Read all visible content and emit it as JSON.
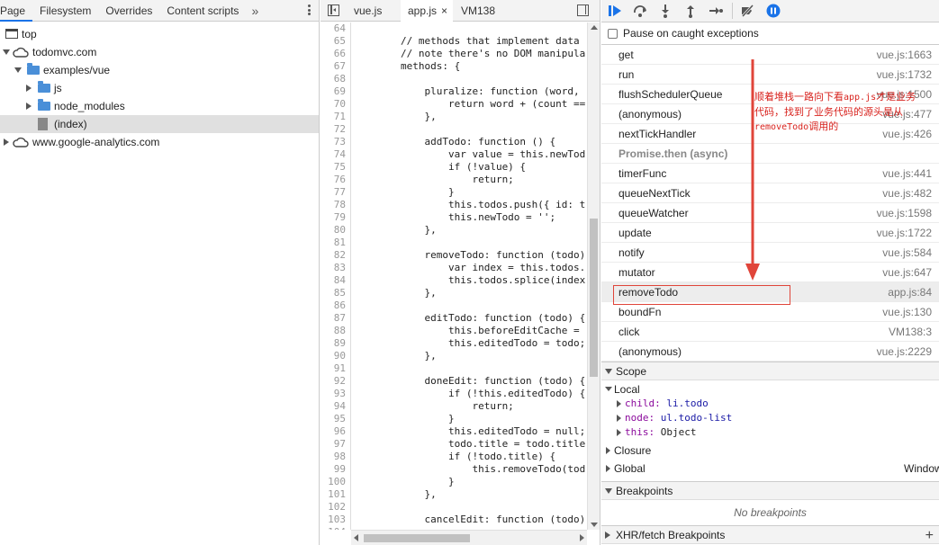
{
  "navigator": {
    "tabs": [
      "Page",
      "Filesystem",
      "Overrides",
      "Content scripts"
    ],
    "more": "»",
    "tree": [
      {
        "label": "top",
        "level": 0,
        "icon": "frame-icon",
        "arrow": "none"
      },
      {
        "label": "todomvc.com",
        "level": 0,
        "icon": "cloud-icon",
        "arrow": "down"
      },
      {
        "label": "examples/vue",
        "level": 1,
        "icon": "folder-icon",
        "arrow": "down"
      },
      {
        "label": "js",
        "level": 2,
        "icon": "folder-icon",
        "arrow": "right"
      },
      {
        "label": "node_modules",
        "level": 2,
        "icon": "folder-icon",
        "arrow": "right"
      },
      {
        "label": "(index)",
        "level": 2,
        "icon": "file-icon",
        "arrow": "none",
        "selected": true
      },
      {
        "label": "www.google-analytics.com",
        "level": 0,
        "icon": "cloud-icon",
        "arrow": "right"
      }
    ]
  },
  "editor": {
    "tabs": [
      {
        "label": "vue.js",
        "active": false
      },
      {
        "label": "app.js",
        "active": true,
        "close": "×"
      },
      {
        "label": "VM138",
        "active": false
      }
    ],
    "lines": [
      {
        "n": "64",
        "t": ""
      },
      {
        "n": "65",
        "t": "        // methods that implement data",
        "c": "cm"
      },
      {
        "n": "66",
        "t": "        // note there's no DOM manipula",
        "c": "cm"
      },
      {
        "n": "67",
        "t": "        methods: {"
      },
      {
        "n": "68",
        "t": ""
      },
      {
        "n": "69",
        "t": "            pluralize: function (word,"
      },
      {
        "n": "70",
        "t": "                return word + (count =="
      },
      {
        "n": "71",
        "t": "            },"
      },
      {
        "n": "72",
        "t": ""
      },
      {
        "n": "73",
        "t": "            addTodo: function () {"
      },
      {
        "n": "74",
        "t": "                var value = this.newTod"
      },
      {
        "n": "75",
        "t": "                if (!value) {"
      },
      {
        "n": "76",
        "t": "                    return;"
      },
      {
        "n": "77",
        "t": "                }"
      },
      {
        "n": "78",
        "t": "                this.todos.push({ id: t"
      },
      {
        "n": "79",
        "t": "                this.newTodo = '';"
      },
      {
        "n": "80",
        "t": "            },"
      },
      {
        "n": "81",
        "t": ""
      },
      {
        "n": "82",
        "t": "            removeTodo: function (todo)"
      },
      {
        "n": "83",
        "t": "                var index = this.todos."
      },
      {
        "n": "84",
        "t": "                this.todos.splice(index"
      },
      {
        "n": "85",
        "t": "            },"
      },
      {
        "n": "86",
        "t": ""
      },
      {
        "n": "87",
        "t": "            editTodo: function (todo) {"
      },
      {
        "n": "88",
        "t": "                this.beforeEditCache ="
      },
      {
        "n": "89",
        "t": "                this.editedTodo = todo;"
      },
      {
        "n": "90",
        "t": "            },"
      },
      {
        "n": "91",
        "t": ""
      },
      {
        "n": "92",
        "t": "            doneEdit: function (todo) {"
      },
      {
        "n": "93",
        "t": "                if (!this.editedTodo) {"
      },
      {
        "n": "94",
        "t": "                    return;"
      },
      {
        "n": "95",
        "t": "                }"
      },
      {
        "n": "96",
        "t": "                this.editedTodo = null;"
      },
      {
        "n": "97",
        "t": "                todo.title = todo.title"
      },
      {
        "n": "98",
        "t": "                if (!todo.title) {"
      },
      {
        "n": "99",
        "t": "                    this.removeTodo(tod"
      },
      {
        "n": "100",
        "t": "                }"
      },
      {
        "n": "101",
        "t": "            },"
      },
      {
        "n": "102",
        "t": ""
      },
      {
        "n": "103",
        "t": "            cancelEdit: function (todo)"
      },
      {
        "n": "104",
        "t": ""
      }
    ]
  },
  "debugger": {
    "pause_on_caught": "Pause on caught exceptions",
    "call_stack": [
      {
        "fn": "get",
        "loc": "vue.js:1663"
      },
      {
        "fn": "run",
        "loc": "vue.js:1732"
      },
      {
        "fn": "flushSchedulerQueue",
        "loc": "vue.js:1500"
      },
      {
        "fn": "(anonymous)",
        "loc": "vue.js:477"
      },
      {
        "fn": "nextTickHandler",
        "loc": "vue.js:426"
      },
      {
        "fn": "Promise.then (async)",
        "loc": "",
        "async": true
      },
      {
        "fn": "timerFunc",
        "loc": "vue.js:441"
      },
      {
        "fn": "queueNextTick",
        "loc": "vue.js:482"
      },
      {
        "fn": "queueWatcher",
        "loc": "vue.js:1598"
      },
      {
        "fn": "update",
        "loc": "vue.js:1722"
      },
      {
        "fn": "notify",
        "loc": "vue.js:584"
      },
      {
        "fn": "mutator",
        "loc": "vue.js:647"
      },
      {
        "fn": "removeTodo",
        "loc": "app.js:84",
        "current": true
      },
      {
        "fn": "boundFn",
        "loc": "vue.js:130"
      },
      {
        "fn": "click",
        "loc": "VM138:3"
      },
      {
        "fn": "(anonymous)",
        "loc": "vue.js:2229"
      }
    ],
    "scope": {
      "title": "Scope",
      "local_title": "Local",
      "local": [
        {
          "key": "child",
          "val": "li.todo"
        },
        {
          "key": "node",
          "val": "ul.todo-list"
        },
        {
          "key": "this",
          "val": "Object"
        }
      ],
      "closure": "Closure",
      "global": "Global",
      "global_val": "Window"
    },
    "breakpoints": {
      "title": "Breakpoints",
      "empty": "No breakpoints"
    },
    "xhr": {
      "title": "XHR/fetch Breakpoints",
      "add": "+"
    }
  },
  "annotation": {
    "line1": "顺着堆栈一路向下看",
    "line1_code": "app.js",
    "line1_tail": "才是业务",
    "line2": "代码，找到了业务代码的源头是从",
    "line3_code": "removeTodo",
    "line3_tail": "调用的",
    "color": "#d8231e"
  },
  "colors": {
    "accent": "#1a73e8",
    "annotation": "#d8231e"
  }
}
